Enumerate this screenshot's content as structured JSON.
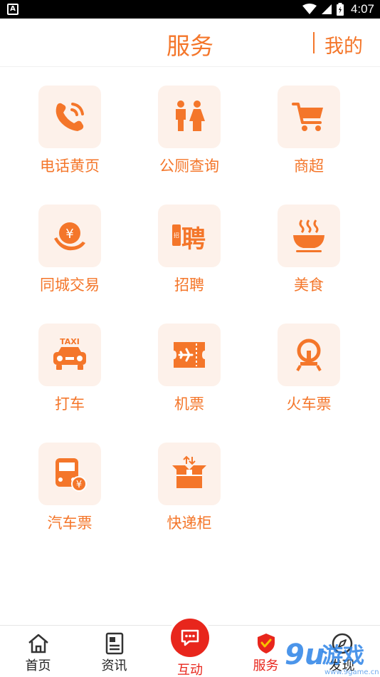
{
  "status_bar": {
    "time": "4:07",
    "left_icon": "notification-a-icon"
  },
  "header": {
    "title": "服务",
    "mine_label": "我的"
  },
  "services": [
    {
      "label": "电话黄页",
      "icon": "phone-icon"
    },
    {
      "label": "公厕查询",
      "icon": "toilet-icon"
    },
    {
      "label": "商超",
      "icon": "cart-icon"
    },
    {
      "label": "同城交易",
      "icon": "money-hand-icon"
    },
    {
      "label": "招聘",
      "icon": "recruit-icon",
      "icon_text": "聘"
    },
    {
      "label": "美食",
      "icon": "bowl-icon"
    },
    {
      "label": "打车",
      "icon": "taxi-icon",
      "icon_text": "TAXI"
    },
    {
      "label": "机票",
      "icon": "plane-ticket-icon"
    },
    {
      "label": "火车票",
      "icon": "train-icon"
    },
    {
      "label": "汽车票",
      "icon": "bus-icon"
    },
    {
      "label": "快递柜",
      "icon": "parcel-box-icon"
    }
  ],
  "bottom_nav": {
    "items": [
      {
        "label": "首页",
        "icon": "home-icon"
      },
      {
        "label": "资讯",
        "icon": "news-icon"
      },
      {
        "label": "互动",
        "icon": "chat-icon"
      },
      {
        "label": "服务",
        "icon": "shield-check-icon"
      },
      {
        "label": "发现",
        "icon": "compass-icon"
      }
    ],
    "active": "服务"
  },
  "watermark": {
    "text": "9u游戏",
    "sub": "www.9game.cn"
  },
  "colors": {
    "accent": "#f4762a",
    "tile_bg": "#fdf1ea",
    "active_red": "#e8261c"
  }
}
